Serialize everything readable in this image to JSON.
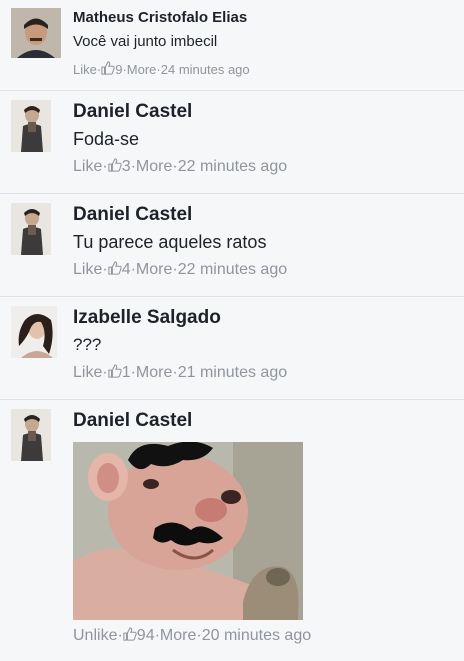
{
  "comments": [
    {
      "author": "Matheus Cristofalo Elias",
      "text": "Você vai junto imbecil",
      "like_label": "Like",
      "like_count": "9",
      "more_label": "More",
      "time": "24 minutes ago"
    },
    {
      "author": "Daniel Castel",
      "text": "Foda-se",
      "like_label": "Like",
      "like_count": "3",
      "more_label": "More",
      "time": "22 minutes ago"
    },
    {
      "author": "Daniel Castel",
      "text": "Tu parece aqueles ratos",
      "like_label": "Like",
      "like_count": "4",
      "more_label": "More",
      "time": "22 minutes ago"
    },
    {
      "author": "Izabelle Salgado",
      "text": "???",
      "like_label": "Like",
      "like_count": "1",
      "more_label": "More",
      "time": "21 minutes ago"
    },
    {
      "author": "Daniel Castel",
      "like_label": "Unlike",
      "like_count": "94",
      "more_label": "More",
      "time": "20 minutes ago"
    }
  ],
  "separator": " · ",
  "colors": {
    "background": "#f6f7f9",
    "text": "#1d2129",
    "meta": "#90949c",
    "divider": "#e1e3e8"
  },
  "icons": {
    "like": "thumbs-up-icon"
  }
}
